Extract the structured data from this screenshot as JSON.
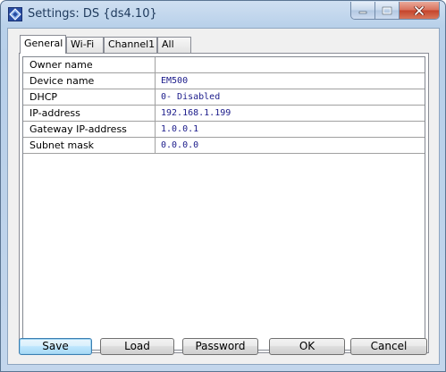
{
  "window": {
    "title": "Settings: DS {ds4.10}"
  },
  "caption_buttons": [
    "minimize-icon",
    "maximize-icon",
    "close-icon"
  ],
  "tabs": [
    {
      "label": "General",
      "active": true
    },
    {
      "label": "Wi-Fi",
      "active": false
    },
    {
      "label": "Channel1",
      "active": false
    },
    {
      "label": "All",
      "active": false
    }
  ],
  "settings": [
    {
      "label": "Owner name",
      "value": ""
    },
    {
      "label": "Device name",
      "value": "EM500"
    },
    {
      "label": "DHCP",
      "value": "0- Disabled"
    },
    {
      "label": "IP-address",
      "value": "192.168.1.199"
    },
    {
      "label": "Gateway IP-address",
      "value": "1.0.0.1"
    },
    {
      "label": "Subnet mask",
      "value": "0.0.0.0"
    }
  ],
  "buttons": {
    "save": "Save",
    "load": "Load",
    "password": "Password",
    "ok": "OK",
    "cancel": "Cancel"
  },
  "colors": {
    "value_text": "#1b1b8a",
    "close_button": "#c4432a",
    "default_button_border": "#3c7fb1"
  }
}
